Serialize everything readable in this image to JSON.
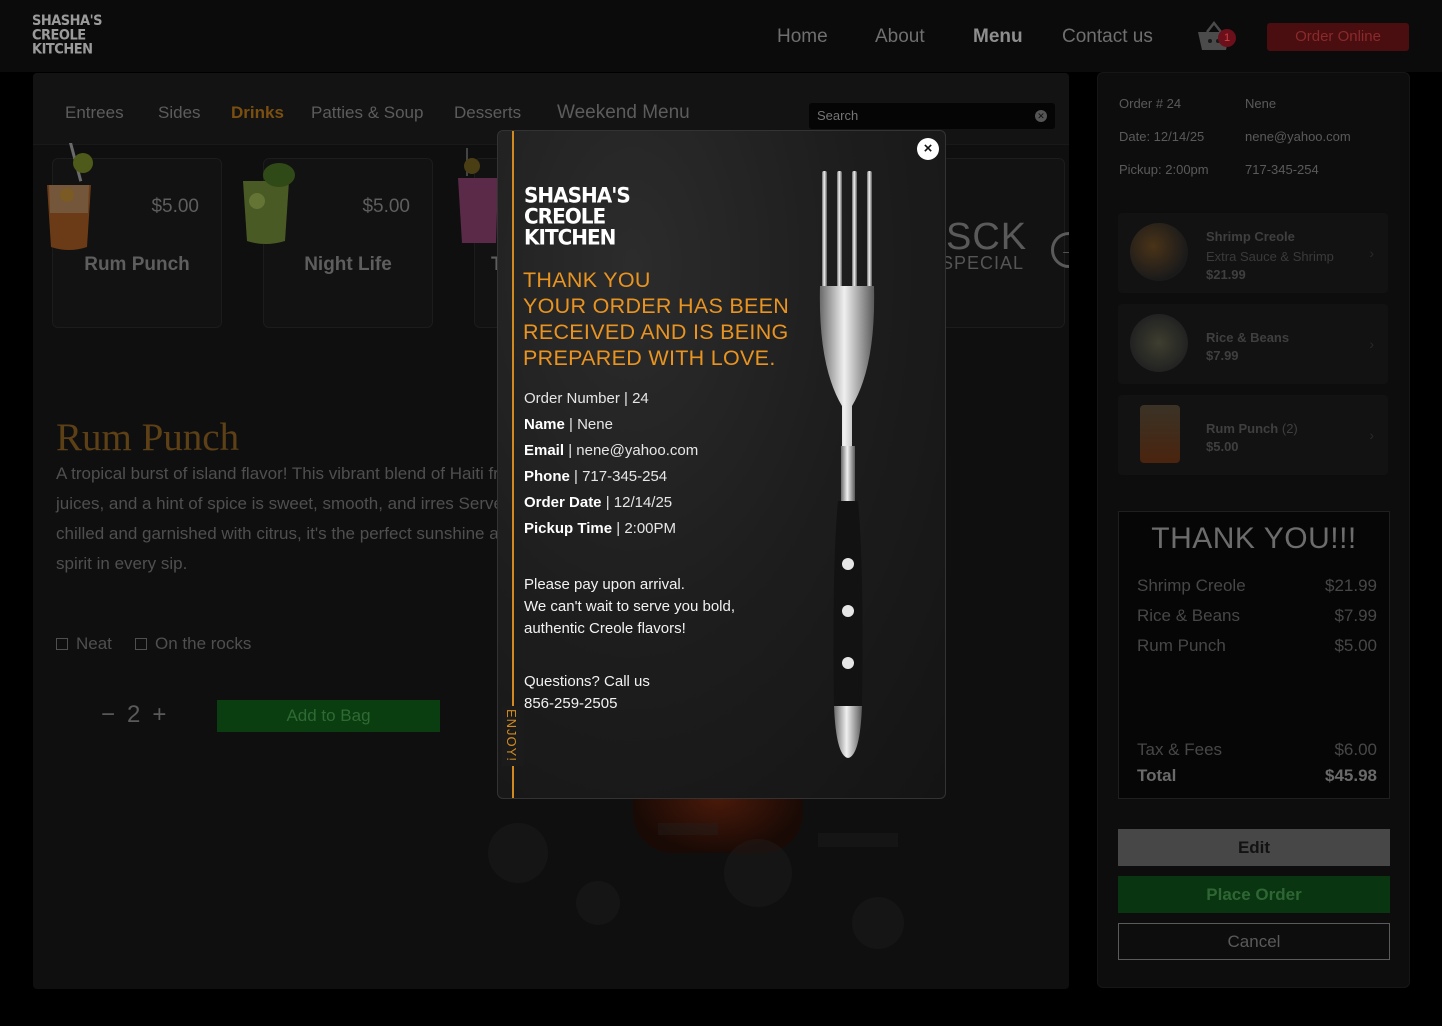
{
  "header": {
    "logo": [
      "SHASHA'S",
      "CREOLE",
      "KITCHEN"
    ],
    "nav": [
      "Home",
      "About",
      "Menu",
      "Contact us"
    ],
    "active_nav": "Menu",
    "cart_count": "1",
    "order_online": "Order Online"
  },
  "menu": {
    "tabs": [
      "Entrees",
      "Sides",
      "Drinks",
      "Patties & Soup",
      "Desserts",
      "Weekend Menu"
    ],
    "active_tab": "Drinks",
    "search_placeholder": "Search",
    "cards": [
      {
        "name": "Rum Punch",
        "price": "$5.00"
      },
      {
        "name": "Night Life",
        "price": "$5.00"
      },
      {
        "name": "T",
        "price": ""
      }
    ],
    "special_card": {
      "title": "SCK",
      "subtitle": "SPECIAL"
    }
  },
  "item": {
    "title": "Rum Punch",
    "description": "A tropical burst of island flavor! This vibrant blend of Haiti fruit juices, and a hint of spice is sweet, smooth, and irres Served chilled and garnished with citrus, it's the perfect sunshine and spirit in every sip.",
    "options": [
      "Neat",
      "On the rocks"
    ],
    "quantity": "2",
    "qty_minus": "−",
    "qty_plus": "+",
    "add_to_bag": "Add to Bag"
  },
  "order": {
    "order_number": "Order # 24",
    "name": "Nene",
    "date": "Date: 12/14/25",
    "email": "nene@yahoo.com",
    "pickup": "Pickup: 2:00pm",
    "phone": "717-345-254",
    "cart_items": [
      {
        "name": "Shrimp Creole",
        "note": "Extra Sauce & Shrimp",
        "price": "$21.99",
        "qty": ""
      },
      {
        "name": "Rice & Beans",
        "note": "",
        "price": "$7.99",
        "qty": ""
      },
      {
        "name": "Rum Punch",
        "note": "",
        "price": "$5.00",
        "qty": "(2)"
      }
    ],
    "receipt": {
      "title": "THANK YOU!!!",
      "lines": [
        {
          "label": "Shrimp Creole",
          "value": "$21.99"
        },
        {
          "label": "Rice & Beans",
          "value": "$7.99"
        },
        {
          "label": "Rum Punch",
          "value": "$5.00"
        }
      ],
      "tax_label": "Tax & Fees",
      "tax_value": "$6.00",
      "total_label": "Total",
      "total_value": "$45.98"
    },
    "edit": "Edit",
    "place_order": "Place Order",
    "cancel": "Cancel"
  },
  "modal": {
    "logo": [
      "SHASHA'S",
      "CREOLE",
      "KITCHEN"
    ],
    "thanks_lines": [
      "THANK YOU",
      "YOUR ORDER HAS BEEN",
      "RECEIVED AND IS BEING",
      "PREPARED WITH LOVE."
    ],
    "order_number_label": "Order Number",
    "order_number": "24",
    "name_label": "Name",
    "name": "Nene",
    "email_label": "Email",
    "email": "nene@yahoo.com",
    "phone_label": "Phone",
    "phone": "717-345-254",
    "order_date_label": "Order Date",
    "order_date": "12/14/25",
    "pickup_label": "Pickup Time",
    "pickup": "2:00PM",
    "pay_lines": [
      "Please pay upon arrival.",
      "We can't wait to serve you bold,",
      "authentic Creole flavors!"
    ],
    "questions": "Questions? Call us",
    "call_number": "856-259-2505",
    "enjoy": "ENJOY!",
    "close": "×"
  },
  "colors": {
    "accent_orange": "#e99420",
    "brand_red": "#4a0d10",
    "place_green": "#093510"
  }
}
